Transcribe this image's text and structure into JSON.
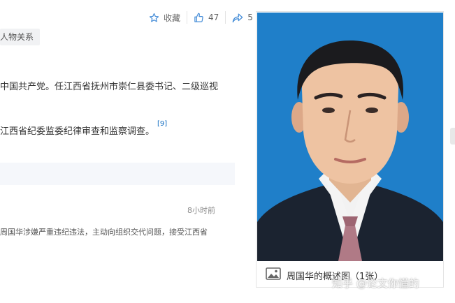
{
  "toolbar": {
    "favorite_label": "收藏",
    "like_count": "47",
    "share_count": "5"
  },
  "tag_label": "人物关系",
  "paragraph1": "中国共产党。任江西省抚州市崇仁县委书记、二级巡视",
  "paragraph2": "江西省纪委监委纪律审查和监察调查。",
  "reference": "[9]",
  "news": {
    "time": "8小时前",
    "snippet": "周国华涉嫌严重违纪违法，主动向组织交代问题，接受江西省"
  },
  "photo": {
    "caption": "周国华的概述图（1张）",
    "watermark": "知乎 @论文你懂的",
    "background_color": "#1f7fc9"
  },
  "icons": [
    "star-icon",
    "thumbs-up-icon",
    "share-icon",
    "image-gallery-icon"
  ],
  "colors": {
    "link": "#136ec2",
    "muted": "#666666",
    "icon_blue": "#4a90d9"
  }
}
